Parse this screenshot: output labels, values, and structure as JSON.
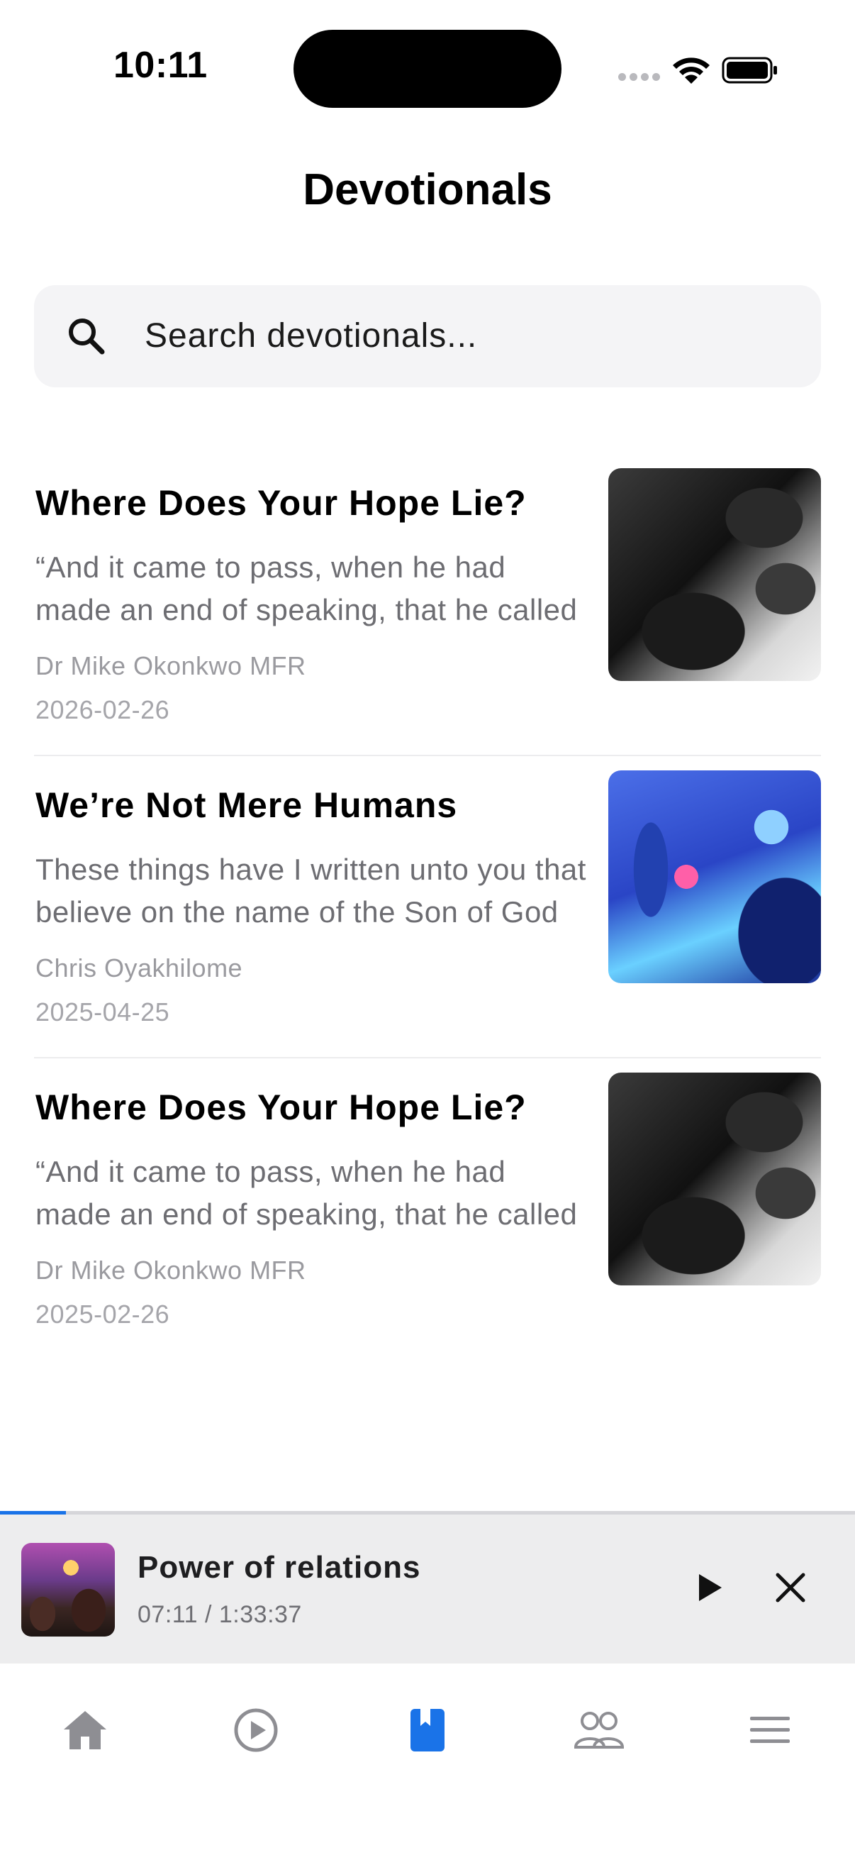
{
  "status_bar": {
    "time": "10:11"
  },
  "header": {
    "title": "Devotionals"
  },
  "search": {
    "placeholder": "Search devotionals..."
  },
  "devotionals": [
    {
      "title": "Where Does Your Hope Lie?",
      "excerpt": "“And it came to pass, when he had made an end of speaking, that he called",
      "author": "Dr Mike Okonkwo MFR",
      "date": "2026-02-26",
      "thumbnail": "man-praying-bw"
    },
    {
      "title": "We’re Not Mere Humans",
      "excerpt": "These things have I written unto you that believe on the name of the Son of God",
      "author": "Chris Oyakhilome",
      "date": "2025-04-25",
      "thumbnail": "worshipper-blue-lights"
    },
    {
      "title": "Where Does Your Hope Lie?",
      "excerpt": "“And it came to pass, when he had made an end of speaking, that he called",
      "author": "Dr Mike Okonkwo MFR",
      "date": "2025-02-26",
      "thumbnail": "man-praying-bw"
    }
  ],
  "player": {
    "title": "Power of relations",
    "time": "07:11 / 1:33:37",
    "progress": 0.077,
    "thumbnail": "church-congregation"
  },
  "tabbar": {
    "items": [
      {
        "icon": "home-icon",
        "active": false
      },
      {
        "icon": "play-circle-icon",
        "active": false
      },
      {
        "icon": "book-icon",
        "active": true
      },
      {
        "icon": "people-icon",
        "active": false
      },
      {
        "icon": "menu-icon",
        "active": false
      }
    ]
  },
  "colors": {
    "accent": "#1a73e8",
    "inactive_icon": "#8e8e93",
    "secondary_text": "#6d6d72"
  }
}
